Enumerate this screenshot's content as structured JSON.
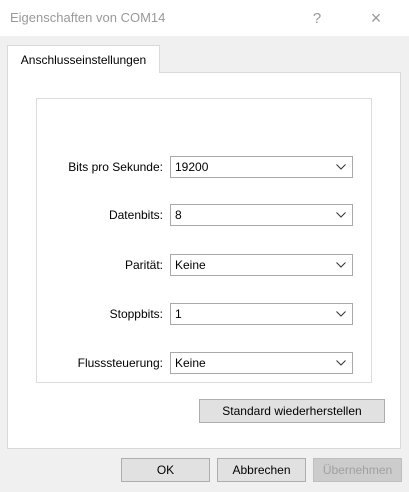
{
  "window": {
    "title": "Eigenschaften von COM14",
    "help_label": "?",
    "close_label": "×"
  },
  "tabs": [
    {
      "label": "Anschlusseinstellungen",
      "selected": true
    }
  ],
  "settings": {
    "bits_per_second": {
      "label": "Bits pro Sekunde:",
      "value": "19200"
    },
    "data_bits": {
      "label": "Datenbits:",
      "value": "8"
    },
    "parity": {
      "label": "Parität:",
      "value": "Keine"
    },
    "stop_bits": {
      "label": "Stoppbits:",
      "value": "1"
    },
    "flow_control": {
      "label": "Flusssteuerung:",
      "value": "Keine"
    }
  },
  "buttons": {
    "restore_defaults": "Standard wiederherstellen",
    "ok": "OK",
    "cancel": "Abbrechen",
    "apply": "Übernehmen"
  },
  "icons": {
    "dropdown": "chevron-down-icon"
  },
  "colors": {
    "title_text": "#999999",
    "disabled_text": "#a0a0a0"
  }
}
